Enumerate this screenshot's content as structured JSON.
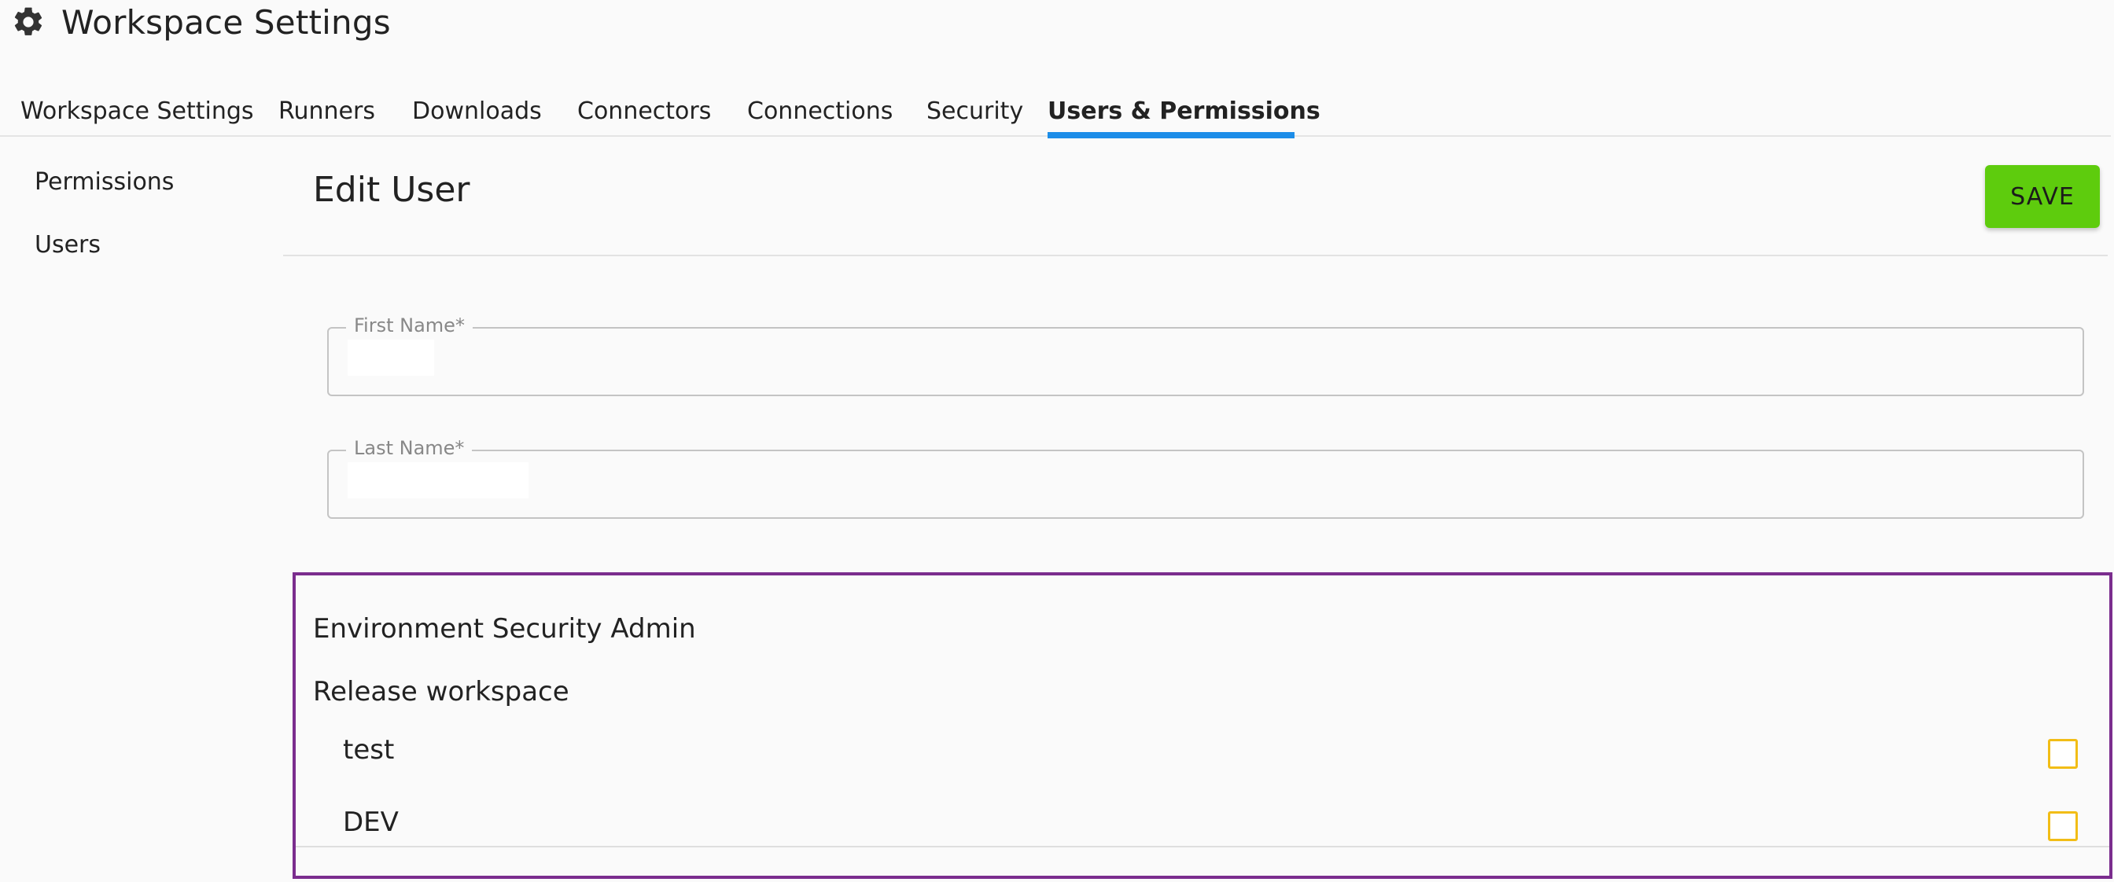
{
  "header": {
    "title": "Workspace Settings",
    "icon": "gear-icon"
  },
  "tabs": [
    {
      "label": "Workspace Settings",
      "active": false
    },
    {
      "label": "Runners",
      "active": false
    },
    {
      "label": "Downloads",
      "active": false
    },
    {
      "label": "Connectors",
      "active": false
    },
    {
      "label": "Connections",
      "active": false
    },
    {
      "label": "Security",
      "active": false
    },
    {
      "label": "Users & Permissions",
      "active": true
    }
  ],
  "sidebar": {
    "items": [
      {
        "label": "Permissions"
      },
      {
        "label": "Users"
      }
    ]
  },
  "main": {
    "title": "Edit User",
    "save_label": "SAVE",
    "fields": {
      "first_name": {
        "label": "First Name*",
        "value": ""
      },
      "last_name": {
        "label": "Last Name*",
        "value": ""
      }
    }
  },
  "permissions": {
    "role": "Environment Security Admin",
    "group": "Release workspace",
    "items": [
      {
        "label": "test",
        "checked": false
      },
      {
        "label": "DEV",
        "checked": false
      }
    ]
  },
  "colors": {
    "accent": "#1c8de8",
    "save": "#5ecc0d",
    "checkbox": "#f2bd16",
    "highlight": "#7b2d8e"
  }
}
